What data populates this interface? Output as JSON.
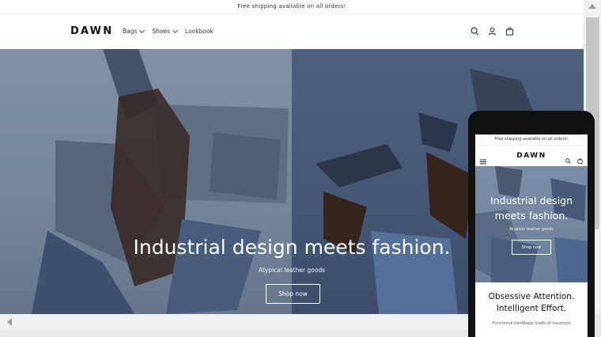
{
  "announcement": "Free shipping available on all orders!",
  "header": {
    "logo": "DAWN",
    "nav": [
      {
        "label": "Bags"
      },
      {
        "label": "Shoes"
      },
      {
        "label": "Lookbook"
      }
    ],
    "icons": [
      "search-icon",
      "account-icon",
      "cart-icon"
    ]
  },
  "hero": {
    "title": "Industrial design meets fashion.",
    "subtitle": "Atypical leather goods",
    "button": "Shop now"
  },
  "mobile": {
    "announcement": "Free shipping available on all orders!",
    "logo": "DAWN",
    "hero_title": "Industrial design meets fashion.",
    "hero_subtitle": "Atypical leather goods",
    "hero_button": "Shop now",
    "section_title": "Obsessive Attention. Intelligent Effort.",
    "section_text": "Functional handbags made of luxurious"
  },
  "colors": {
    "hero_left": "#8b9db3",
    "hero_right": "#55698a",
    "phone_frame": "#111111"
  }
}
